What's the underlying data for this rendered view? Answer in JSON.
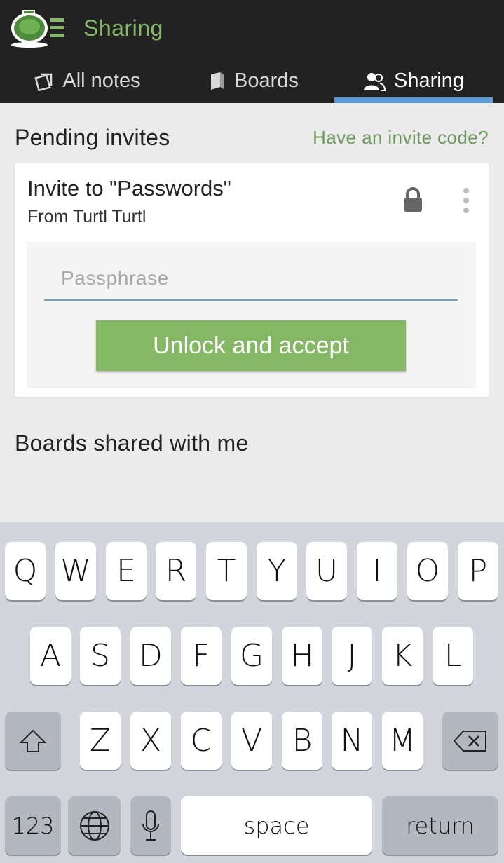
{
  "header": {
    "app_title": "Sharing",
    "tabs": [
      {
        "label": "All notes",
        "icon": "notes-icon",
        "active": false
      },
      {
        "label": "Boards",
        "icon": "board-icon",
        "active": false
      },
      {
        "label": "Sharing",
        "icon": "users-icon",
        "active": true
      }
    ],
    "accent_color": "#86b86a",
    "tab_indicator_color": "#5b9bd8"
  },
  "pending": {
    "title": "Pending invites",
    "invite_code_link": "Have an invite code?"
  },
  "invite": {
    "title": "Invite to \"Passwords\"",
    "from": "From Turtl Turtl",
    "passphrase_placeholder": "Passphrase",
    "passphrase_value": "",
    "button_label": "Unlock and accept",
    "button_color": "#84b865"
  },
  "shared": {
    "title": "Boards shared with me"
  },
  "keyboard": {
    "row1": [
      "Q",
      "W",
      "E",
      "R",
      "T",
      "Y",
      "U",
      "I",
      "O",
      "P"
    ],
    "row2": [
      "A",
      "S",
      "D",
      "F",
      "G",
      "H",
      "J",
      "K",
      "L"
    ],
    "row3": [
      "Z",
      "X",
      "C",
      "V",
      "B",
      "N",
      "M"
    ],
    "numbers_label": "123",
    "space_label": "space",
    "return_label": "return"
  }
}
